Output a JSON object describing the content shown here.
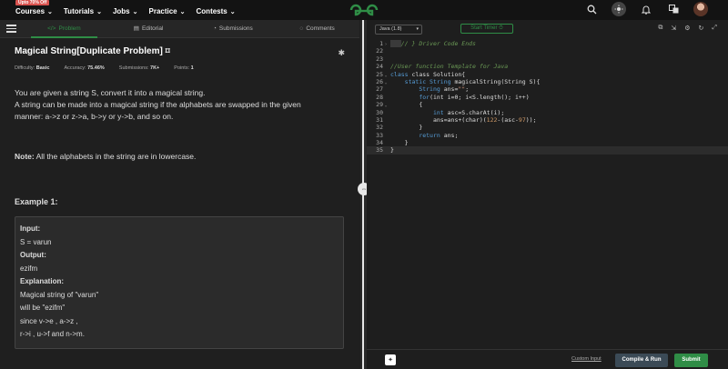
{
  "topnav": {
    "promo": "Upto 70% Off",
    "items": [
      "Courses",
      "Tutorials",
      "Jobs",
      "Practice",
      "Contests"
    ],
    "icons": [
      "search-icon",
      "theme-icon",
      "notification-bell-icon",
      "translate-icon"
    ]
  },
  "tabs": {
    "problem": "Problem",
    "editorial": "Editorial",
    "submissions": "Submissions",
    "comments": "Comments"
  },
  "problem": {
    "title": "Magical String[Duplicate Problem]",
    "difficulty_label": "Difficulty:",
    "difficulty_value": "Basic",
    "accuracy_label": "Accuracy:",
    "accuracy_value": "75.46%",
    "submissions_label": "Submissions:",
    "submissions_value": "7K+",
    "points_label": "Points:",
    "points_value": "1",
    "desc_line1": "You are given a string S, convert it into a magical string.",
    "desc_line2": "A string can be made into a magical string if the alphabets are swapped in the given",
    "desc_line3": "manner: a->z or z->a, b->y or y->b, and so on.",
    "note_label": "Note:",
    "note_text": " All the alphabets in the string are in lowercase.",
    "example_heading": "Example 1:",
    "ex_input_label": "Input:",
    "ex_input": "S = varun",
    "ex_output_label": "Output:",
    "ex_output": "ezifm",
    "ex_expl_label": "Explanation:",
    "ex_expl1": "Magical string of \"varun\"",
    "ex_expl2": "will be \"ezifm\"",
    "ex_expl3": "since v->e , a->z ,",
    "ex_expl4": "r->i , u->f and n->m."
  },
  "editor": {
    "language": "Java (1.8)",
    "timer_label": "Start Timer",
    "line_numbers": [
      "1",
      "22",
      "23",
      "24",
      "25",
      "26",
      "27",
      "28",
      "29",
      "30",
      "31",
      "32",
      "33",
      "34",
      "35"
    ],
    "comment_driver": "// } Driver Code Ends",
    "comment_template": "//User function Template for Java",
    "l25": "class Solution{",
    "l26_kw": "static String",
    "l26": " magicalString(String S){",
    "l27_kw": "String",
    "l27": " ans=",
    "l27_str": "\"\"",
    "l28_kw": "for",
    "l28": "(int i=0; i<S.length(); i++)",
    "l29": "{",
    "l30_kw": "int",
    "l30": " asc=S.charAt(i);",
    "l31": "ans=ans+(char)(",
    "l31_num": "122",
    "l31_b": "-(asc-",
    "l31_num2": "97",
    "l31_c": "));",
    "l32": "}",
    "l33_kw": "return",
    "l33": " ans;",
    "l34": "}",
    "l35": "}"
  },
  "bottom": {
    "custom_input": "Custom Input",
    "compile_run": "Compile & Run",
    "submit": "Submit"
  }
}
